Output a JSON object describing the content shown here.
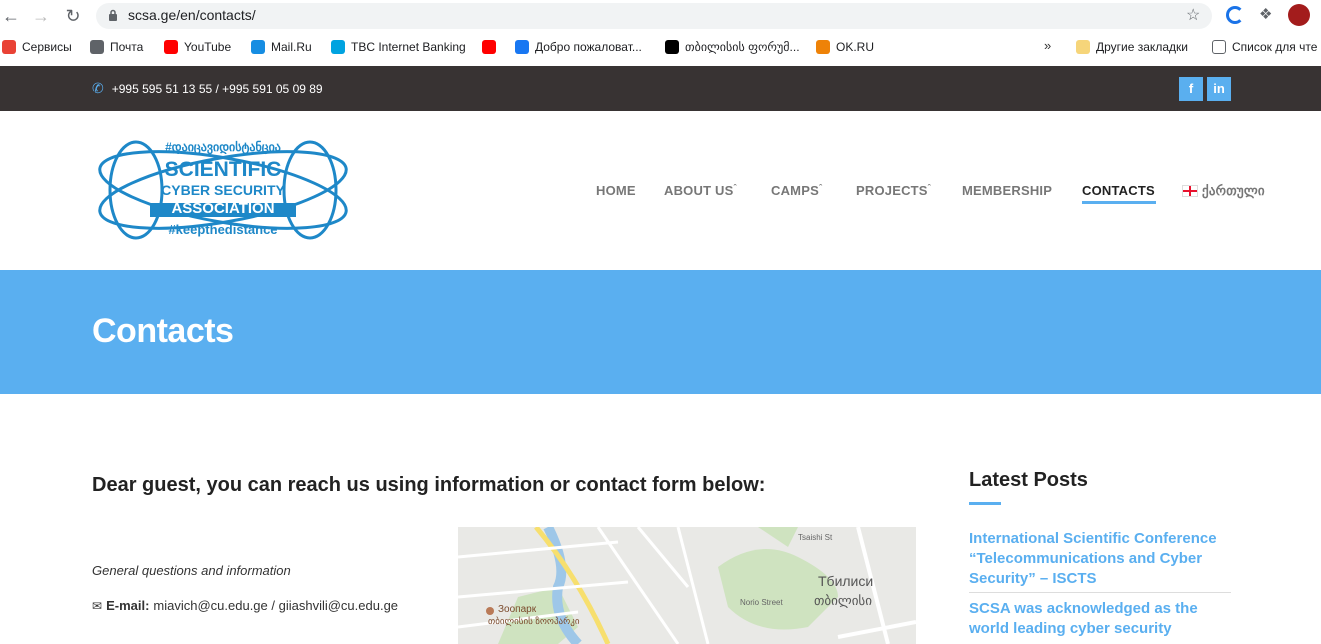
{
  "browser": {
    "url": "scsa.ge/en/contacts/",
    "bookmarks": [
      {
        "label": "Сервисы",
        "color": "#e94235"
      },
      {
        "label": "Почта",
        "color": "#5f6368"
      },
      {
        "label": "YouTube",
        "color": "#ff0000"
      },
      {
        "label": "Mail.Ru",
        "color": "#168de2"
      },
      {
        "label": "TBC Internet Banking",
        "color": "#00a3e0"
      },
      {
        "label": "",
        "color": "#ff0000"
      },
      {
        "label": "Добро пожаловат...",
        "color": "#1877f2"
      },
      {
        "label": "თბილისის ფორუმ...",
        "color": "#000000"
      },
      {
        "label": "OK.RU",
        "color": "#ee8208"
      }
    ],
    "more": "»",
    "other_bookmarks": "Другие закладки",
    "reading_list": "Список для чте"
  },
  "topbar": {
    "phone": "+995 595 51 13 55 / +995 591 05 09 89",
    "social": [
      "f",
      "in"
    ]
  },
  "logo": {
    "line1": "#დაიცავიდისტანცია",
    "line2": "SCIENTIFIC",
    "line3": "CYBER SECURITY",
    "line4": "ASSOCIATION",
    "line5": "#keepthedistance"
  },
  "nav": {
    "items": [
      "HOME",
      "ABOUT US",
      "CAMPS",
      "PROJECTS",
      "MEMBERSHIP",
      "CONTACTS"
    ],
    "lang": "ქართული"
  },
  "hero": {
    "title": "Contacts"
  },
  "content": {
    "intro": "Dear guest, you can reach us using information or contact form below:",
    "general": "General questions and information",
    "email_label": "E-mail:",
    "email_value": "miavich@cu.edu.ge / giiashvili@cu.edu.ge"
  },
  "map": {
    "city_ru": "Тбилиси",
    "city_ka": "თბილისი",
    "zoo_ru": "Зоопарк",
    "zoo_ka": "თბილისის ზოოპარკი",
    "street1": "Tsaishi St",
    "street2": "Norio Street"
  },
  "sidebar": {
    "title": "Latest Posts",
    "posts": [
      "International Scientific Conference “Telecommunications and Cyber Security” – ISCTS",
      "SCSA was acknowledged as the world leading cyber security"
    ]
  },
  "colors": {
    "accent": "#5aaff0",
    "topbar": "#383333",
    "logo": "#1e88c8"
  }
}
